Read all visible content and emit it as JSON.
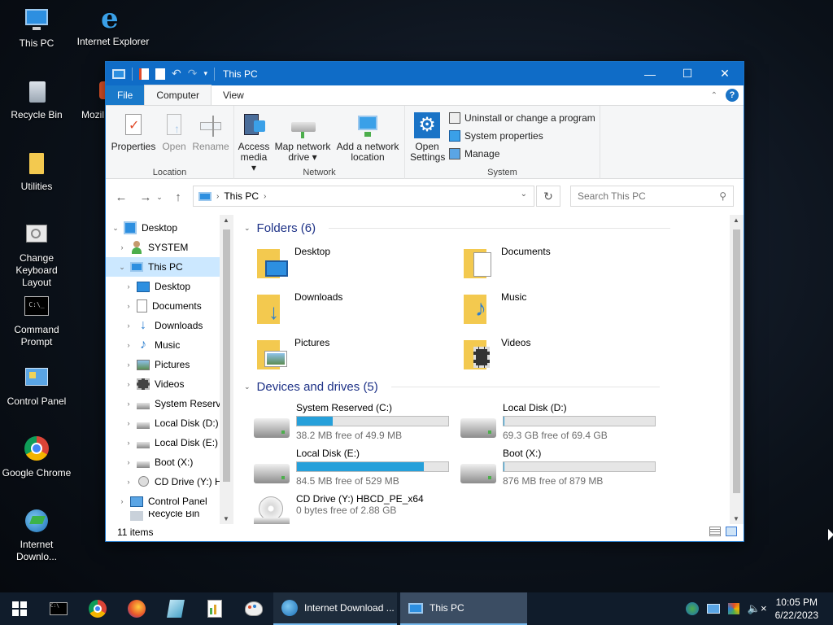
{
  "desktop": {
    "icons": [
      {
        "label": "This PC"
      },
      {
        "label": "Internet Explorer"
      },
      {
        "label": "Recycle Bin"
      },
      {
        "label": "Mozil"
      },
      {
        "label": "Utilities"
      },
      {
        "label": "Change Keyboard Layout"
      },
      {
        "label": "Command Prompt"
      },
      {
        "label": "Control Panel"
      },
      {
        "label": "Google Chrome"
      },
      {
        "label": "Internet Downlo..."
      }
    ]
  },
  "window": {
    "title": "This PC",
    "tabs": {
      "file": "File",
      "computer": "Computer",
      "view": "View"
    },
    "ribbon": {
      "location": {
        "label": "Location",
        "properties": "Properties",
        "open": "Open",
        "rename": "Rename"
      },
      "network": {
        "label": "Network",
        "access_media": "Access media",
        "map_network_drive": "Map network drive",
        "add_network_location": "Add a network location"
      },
      "system": {
        "label": "System",
        "open_settings": "Open Settings",
        "uninstall": "Uninstall or change a program",
        "system_properties": "System properties",
        "manage": "Manage"
      }
    },
    "address": {
      "crumb": "This PC",
      "search_placeholder": "Search This PC"
    },
    "navpane": [
      {
        "label": "Desktop",
        "level": 0,
        "expanded": true
      },
      {
        "label": "SYSTEM",
        "level": 1
      },
      {
        "label": "This PC",
        "level": 1,
        "expanded": true,
        "selected": true
      },
      {
        "label": "Desktop",
        "level": 2
      },
      {
        "label": "Documents",
        "level": 2
      },
      {
        "label": "Downloads",
        "level": 2
      },
      {
        "label": "Music",
        "level": 2
      },
      {
        "label": "Pictures",
        "level": 2
      },
      {
        "label": "Videos",
        "level": 2
      },
      {
        "label": "System Reserve",
        "level": 2
      },
      {
        "label": "Local Disk (D:)",
        "level": 2
      },
      {
        "label": "Local Disk (E:)",
        "level": 2
      },
      {
        "label": "Boot (X:)",
        "level": 2
      },
      {
        "label": "CD Drive (Y:) H",
        "level": 2
      },
      {
        "label": "Control Panel",
        "level": 1
      },
      {
        "label": "Recycle Bin",
        "level": 1
      }
    ],
    "folders_header": "Folders (6)",
    "folders": [
      {
        "name": "Desktop"
      },
      {
        "name": "Documents"
      },
      {
        "name": "Downloads"
      },
      {
        "name": "Music"
      },
      {
        "name": "Pictures"
      },
      {
        "name": "Videos"
      }
    ],
    "drives_header": "Devices and drives (5)",
    "drives": [
      {
        "name": "System Reserved (C:)",
        "free": "38.2 MB free of 49.9 MB",
        "used_fraction": 0.234
      },
      {
        "name": "Local Disk (D:)",
        "free": "69.3 GB free of 69.4 GB",
        "used_fraction": 0.0015
      },
      {
        "name": "Local Disk (E:)",
        "free": "84.5 MB free of 529 MB",
        "used_fraction": 0.84
      },
      {
        "name": "Boot (X:)",
        "free": "876 MB free of 879 MB",
        "used_fraction": 0.003
      },
      {
        "name": "CD Drive (Y:) HBCD_PE_x64",
        "free": "0 bytes free of 2.88 GB"
      }
    ],
    "status": "11 items"
  },
  "taskbar": {
    "ie_task": "Internet Download ...",
    "pc_task": "This PC",
    "time": "10:05 PM",
    "date": "6/22/2023"
  }
}
